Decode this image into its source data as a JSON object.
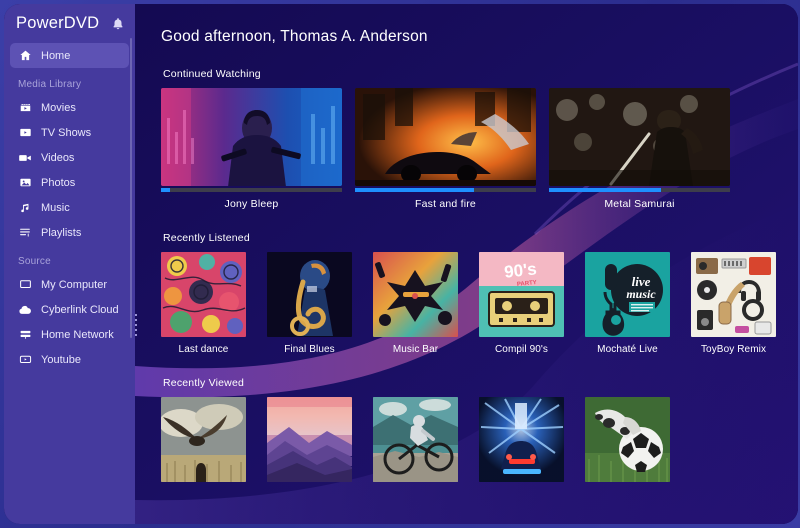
{
  "app": {
    "brand": "PowerDVD",
    "notification_icon": "bell-icon"
  },
  "sidebar": {
    "home": {
      "label": "Home",
      "icon": "home-icon"
    },
    "media_library_label": "Media Library",
    "media_library": [
      {
        "label": "Movies",
        "icon": "clapperboard-icon"
      },
      {
        "label": "TV Shows",
        "icon": "tv-icon"
      },
      {
        "label": "Videos",
        "icon": "camcorder-icon"
      },
      {
        "label": "Photos",
        "icon": "photo-icon"
      },
      {
        "label": "Music",
        "icon": "music-note-icon"
      },
      {
        "label": "Playlists",
        "icon": "playlist-icon"
      }
    ],
    "source_label": "Source",
    "sources": [
      {
        "label": "My Computer",
        "icon": "monitor-icon"
      },
      {
        "label": "Cyberlink Cloud",
        "icon": "cloud-icon"
      },
      {
        "label": "Home Network",
        "icon": "network-icon"
      },
      {
        "label": "Youtube",
        "icon": "youtube-icon"
      }
    ]
  },
  "main": {
    "greeting": "Good afternoon, Thomas A. Anderson",
    "continued_watching": {
      "title": "Continued Watching",
      "items": [
        {
          "title": "Jony Bleep",
          "progress": 5,
          "art": "neon-action"
        },
        {
          "title": "Fast and fire",
          "progress": 66,
          "art": "car-fire"
        },
        {
          "title": "Metal Samurai",
          "progress": 62,
          "art": "samurai"
        }
      ]
    },
    "recently_listened": {
      "title": "Recently Listened",
      "items": [
        {
          "title": "Last dance",
          "art": "doodle"
        },
        {
          "title": "Final Blues",
          "art": "sax"
        },
        {
          "title": "Music Bar",
          "art": "splash"
        },
        {
          "title": "Compil 90's",
          "art": "cassette"
        },
        {
          "title": "Mochaté Live",
          "art": "livemusic"
        },
        {
          "title": "ToyBoy Remix",
          "art": "gear"
        }
      ]
    },
    "recently_viewed": {
      "title": "Recently Viewed",
      "items": [
        {
          "art": "eagle"
        },
        {
          "art": "mountains"
        },
        {
          "art": "biker"
        },
        {
          "art": "tunnel-car"
        },
        {
          "art": "soccer"
        }
      ]
    }
  },
  "colors": {
    "sidebar": "#453a9e",
    "content_bg": "#150b52",
    "accent": "#1e90ff",
    "active_nav": "#5d52b4",
    "window_frame": "#2e3192"
  }
}
